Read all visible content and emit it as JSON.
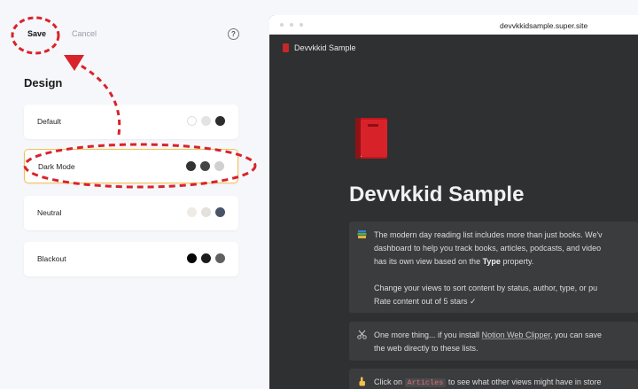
{
  "editor": {
    "save_label": "Save",
    "cancel_label": "Cancel",
    "help_icon": "question-circle-icon",
    "design_title": "Design",
    "themes": [
      {
        "label": "Default",
        "selected": false,
        "swatches": [
          "#ffffff",
          "#e3e3e3",
          "#2d2d2d"
        ]
      },
      {
        "label": "Dark Mode",
        "selected": true,
        "swatches": [
          "#333333",
          "#444444",
          "#d0d0d0"
        ]
      },
      {
        "label": "Neutral",
        "selected": false,
        "swatches": [
          "#eeeae5",
          "#e4e0db",
          "#4a5468"
        ]
      },
      {
        "label": "Blackout",
        "selected": false,
        "swatches": [
          "#050505",
          "#1c1c1c",
          "#606060"
        ]
      }
    ]
  },
  "preview": {
    "url": "devvkkidsample.super.site",
    "site_title": "Devvkkid Sample",
    "page_icon": "red-book-icon",
    "page_title": "Devvkkid Sample",
    "callouts": [
      {
        "icon": "books-icon",
        "lines": [
          "The modern day reading list includes more than just books. We'v",
          "dashboard to help you track books, articles, podcasts, and video",
          "has its own view based on the",
          "Type",
          "property.",
          "Change your views to sort content by status, author, type, or pu",
          "Rate content out of 5 stars ✓"
        ]
      },
      {
        "icon": "scissors-icon",
        "line1_pre": "One more thing... if you install",
        "link": "Notion Web Clipper",
        "line1_post": ", you can save",
        "line2": "the web directly to these lists."
      },
      {
        "icon": "pointing-hand-icon",
        "pre": "Click on",
        "code": "Articles",
        "post": "to see what other views might have in store"
      }
    ]
  },
  "annotations": {
    "color": "#d8232a"
  }
}
